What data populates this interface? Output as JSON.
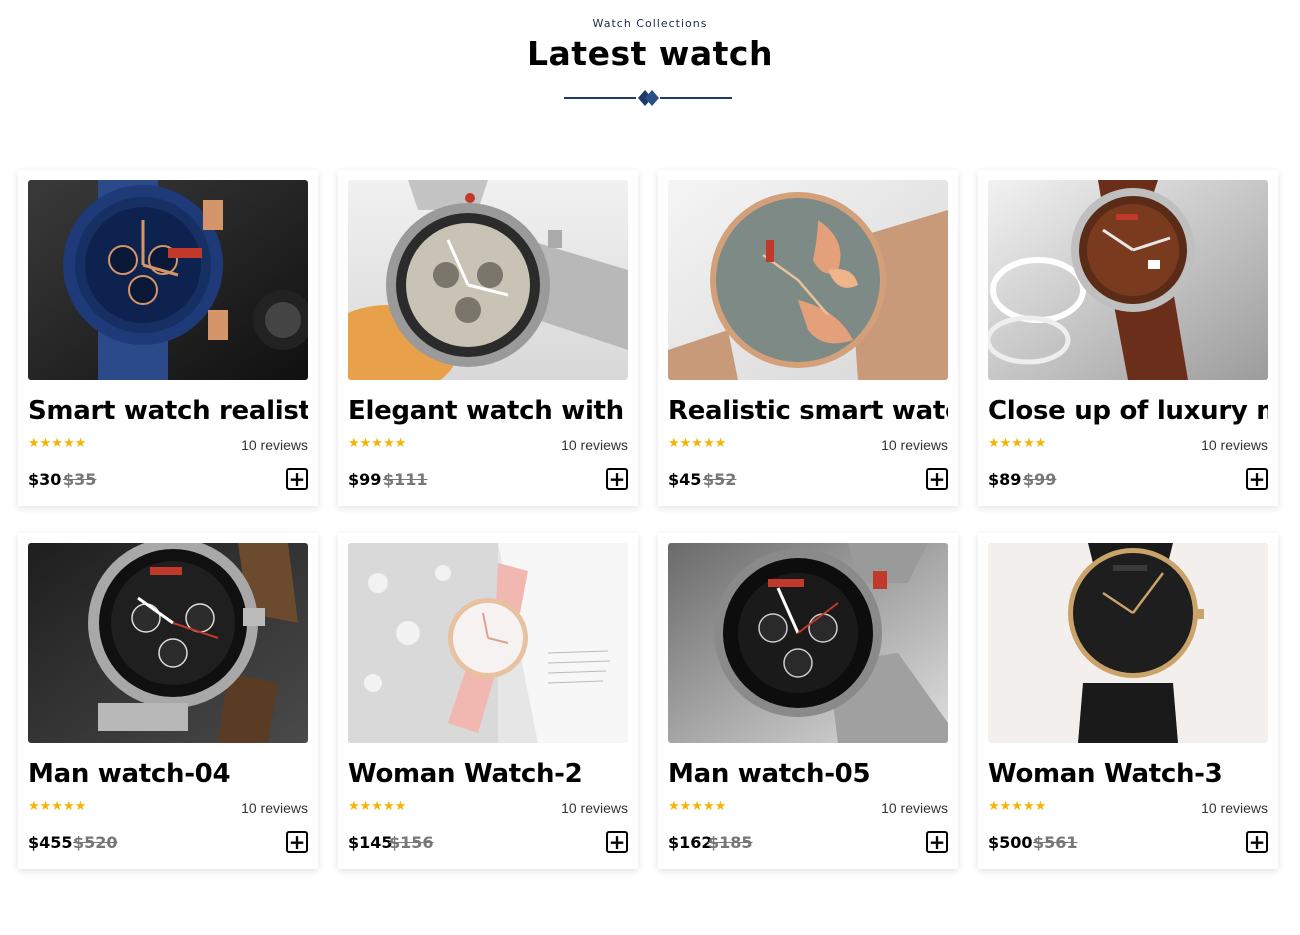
{
  "header": {
    "eyebrow": "Watch Collections",
    "title": "Latest watch",
    "accent_color": "#1e3a68"
  },
  "products": [
    {
      "name": "Smart watch realistic",
      "rating": 5,
      "stars": "★★★★★",
      "reviews": "10 reviews",
      "price": "$30",
      "old_price": "$35",
      "image": "blue-chronograph-watch"
    },
    {
      "name": "Elegant watch with a s",
      "rating": 5,
      "stars": "★★★★★",
      "reviews": "10 reviews",
      "price": "$99",
      "old_price": "$111",
      "image": "silver-chronograph-watch"
    },
    {
      "name": "Realistic smart watch",
      "rating": 5,
      "stars": "★★★★★",
      "reviews": "10 reviews",
      "price": "$45",
      "old_price": "$52",
      "image": "rose-gold-floral-watch"
    },
    {
      "name": "Close up of luxury man",
      "rating": 5,
      "stars": "★★★★★",
      "reviews": "10 reviews",
      "price": "$89",
      "old_price": "$99",
      "image": "brown-leather-watch"
    },
    {
      "name": "Man watch-04",
      "rating": 5,
      "stars": "★★★★★",
      "reviews": "10 reviews",
      "price": "$455",
      "old_price": "$520",
      "image": "black-silver-chronograph-watch"
    },
    {
      "name": "Woman Watch-2",
      "rating": 5,
      "stars": "★★★★★",
      "reviews": "10 reviews",
      "price": "$145",
      "old_price": "$156",
      "image": "pink-leather-watch"
    },
    {
      "name": "Man watch-05",
      "rating": 5,
      "stars": "★★★★★",
      "reviews": "10 reviews",
      "price": "$162",
      "old_price": "$185",
      "image": "steel-sport-chronograph-watch"
    },
    {
      "name": "Woman Watch-3",
      "rating": 5,
      "stars": "★★★★★",
      "reviews": "10 reviews",
      "price": "$500",
      "old_price": "$561",
      "image": "black-mesh-minimal-watch"
    }
  ],
  "add_icon": "plus-square-icon",
  "star_color": "#f4b400"
}
